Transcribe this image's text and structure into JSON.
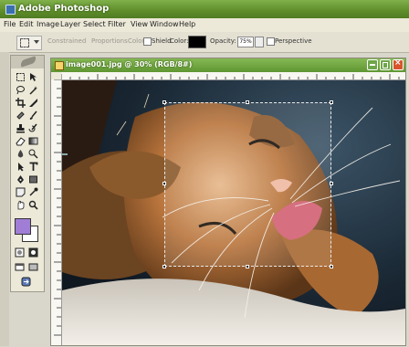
{
  "app": {
    "title": "Adobe Photoshop"
  },
  "menu": {
    "items": [
      "File",
      "Edit",
      "Image",
      "Layer",
      "Select",
      "Filter",
      "View",
      "Window",
      "Help"
    ]
  },
  "options_bar": {
    "tool_icon": "rectangular-marquee-icon",
    "opt1_label": "Constrained",
    "opt2_label": "Proportions",
    "mode_label": "Color",
    "shield_label": "Shield",
    "color_label": "Color:",
    "shield_color": "#000000",
    "opacity_label": "Opacity:",
    "opacity_value": "75%",
    "perspective_label": "Perspective"
  },
  "toolbox": {
    "foreground_color": "#a07ed6",
    "background_color": "#ffffff"
  },
  "document": {
    "title": "image001.jpg @ 30% (RGB/8#)"
  }
}
